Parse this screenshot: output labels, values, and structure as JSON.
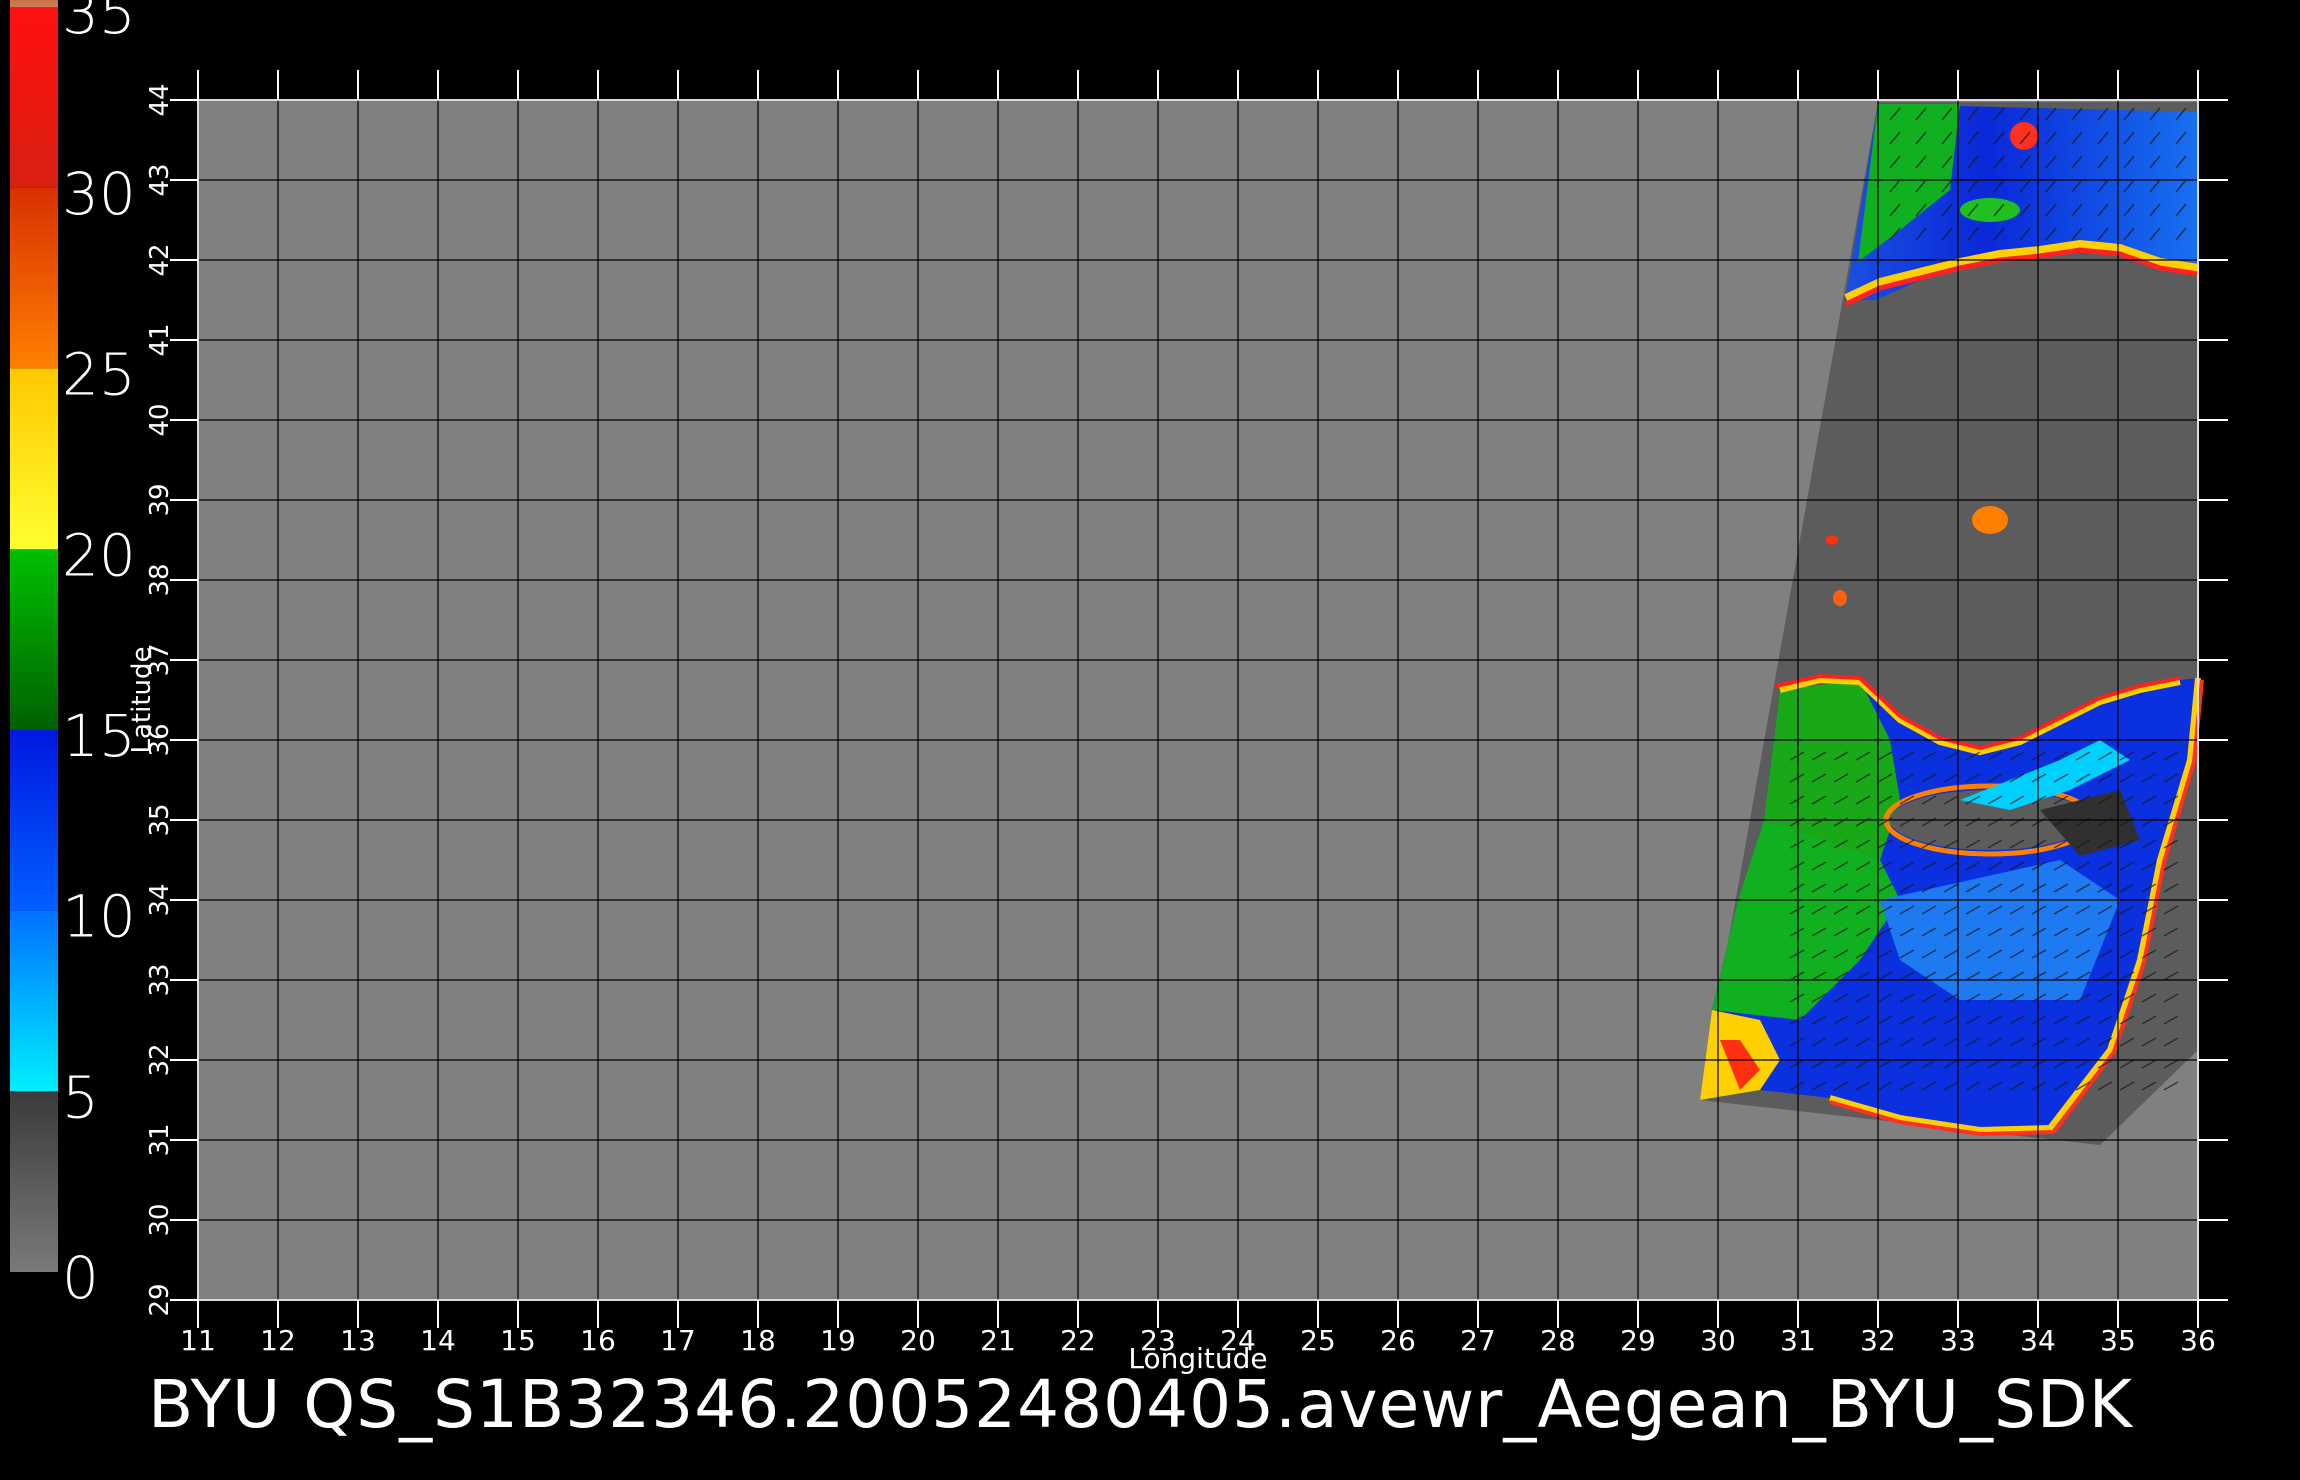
{
  "caption": "BYU  QS_S1B32346.20052480405.avewr_Aegean_BYU_SDK",
  "colorbar": {
    "labels": [
      "0",
      "5",
      "10",
      "15",
      "20",
      "25",
      "30",
      "35"
    ],
    "segments": [
      {
        "from": 0,
        "to": 5,
        "color_top": "#3a3a3a",
        "color_bottom": "#7a7a7a"
      },
      {
        "from": 5,
        "to": 10,
        "color_top": "#0070ff",
        "color_bottom": "#00f0ff"
      },
      {
        "from": 10,
        "to": 15,
        "color_top": "#0018e0",
        "color_bottom": "#0060ff"
      },
      {
        "from": 15,
        "to": 20,
        "color_top": "#00c000",
        "color_bottom": "#006000"
      },
      {
        "from": 20,
        "to": 25,
        "color_top": "#ffc800",
        "color_bottom": "#ffff30"
      },
      {
        "from": 25,
        "to": 30,
        "color_top": "#d83000",
        "color_bottom": "#ff8000"
      },
      {
        "from": 30,
        "to": 35,
        "color_top": "#ff1010",
        "color_bottom": "#d82010"
      },
      {
        "from": 35,
        "to": 37,
        "color_top": "#c87040",
        "color_bottom": "#d08060"
      }
    ]
  },
  "map": {
    "xlabel": "Longitude",
    "ylabel": "Latitude",
    "lon_ticks": [
      "11",
      "12",
      "13",
      "14",
      "15",
      "16",
      "17",
      "18",
      "19",
      "20",
      "21",
      "22",
      "23",
      "24",
      "25",
      "26",
      "27",
      "28",
      "29",
      "30",
      "31",
      "32",
      "33",
      "34",
      "35",
      "36"
    ],
    "lat_ticks": [
      "29",
      "30",
      "31",
      "32",
      "33",
      "34",
      "35",
      "36",
      "37",
      "38",
      "39",
      "40",
      "41",
      "42",
      "43",
      "44"
    ],
    "lon_range": [
      11,
      36
    ],
    "lat_range": [
      29,
      44
    ],
    "background_color": "#808080",
    "grid_color": "#000000"
  }
}
